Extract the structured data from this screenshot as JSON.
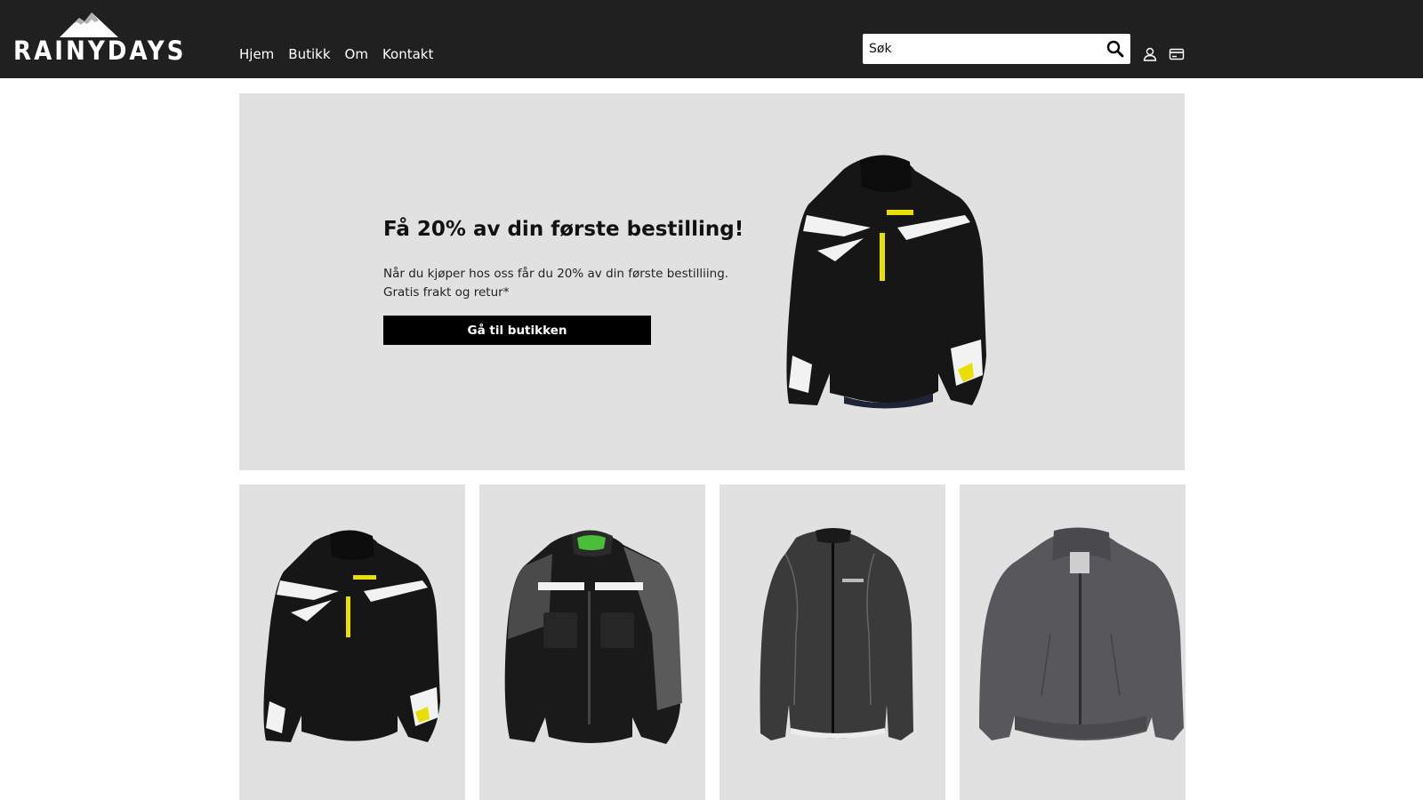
{
  "brand": {
    "name": "RAINYDAYS",
    "logo_icon": "mountain-icon"
  },
  "nav": {
    "items": [
      {
        "label": "Hjem"
      },
      {
        "label": "Butikk"
      },
      {
        "label": "Om"
      },
      {
        "label": "Kontakt"
      }
    ]
  },
  "search": {
    "placeholder": "Søk",
    "value": "",
    "icon": "search-icon"
  },
  "header_icons": {
    "account": "user-icon",
    "cart": "card-icon"
  },
  "hero": {
    "title": "Få 20% av din første bestilling!",
    "text_line1": "Når du kjøper hos oss får du 20% av din første bestilliing.",
    "text_line2": "Gratis frakt og retur*",
    "button_label": "Gå til butikken"
  },
  "products": [
    {
      "image": "black-white-yellow-jacket"
    },
    {
      "image": "black-grey-motorcycle-jacket"
    },
    {
      "image": "dark-grey-windbreaker"
    },
    {
      "image": "grey-bomber-jacket"
    }
  ],
  "colors": {
    "header_bg": "#202020",
    "panel_bg": "#e1e1e1",
    "button_bg": "#000000",
    "accent_yellow": "#e8e000"
  }
}
